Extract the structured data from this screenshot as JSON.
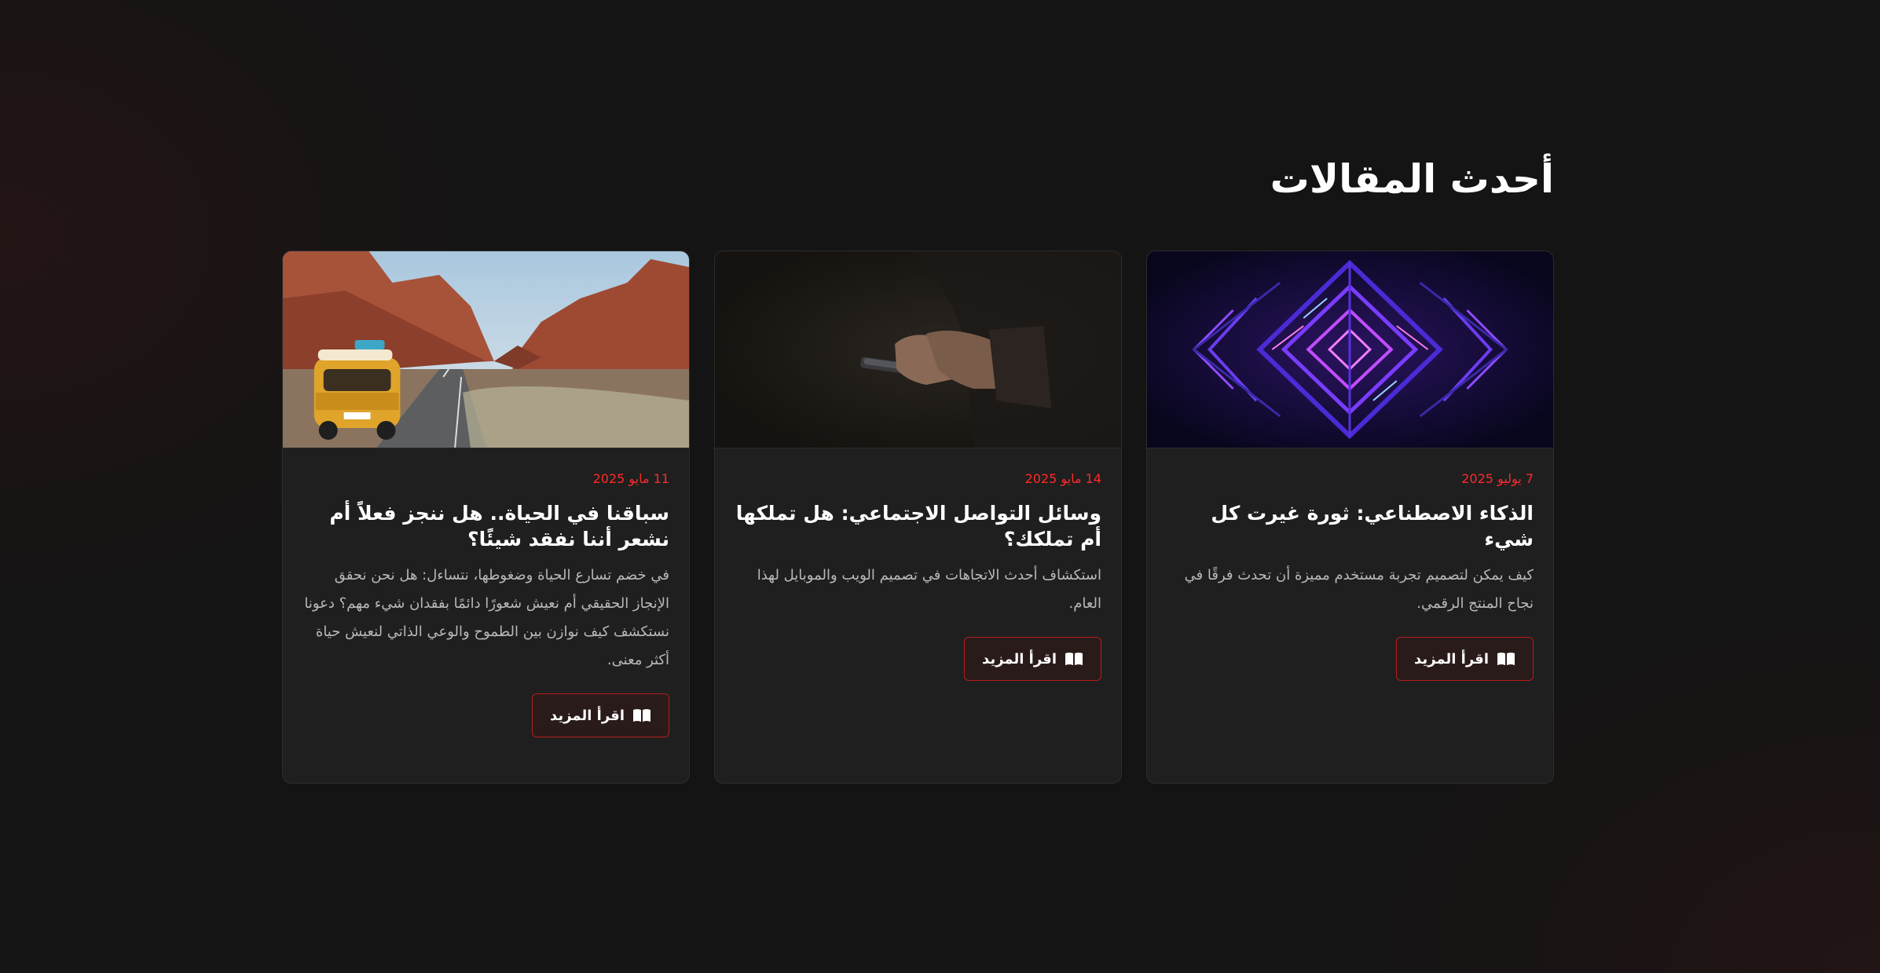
{
  "section": {
    "title": "أحدث المقالات"
  },
  "articles": [
    {
      "date": "7 يوليو 2025",
      "title": "الذكاء الاصطناعي: ثورة غيرت كل شيء",
      "excerpt": "كيف يمكن لتصميم تجربة مستخدم مميزة أن تحدث فرقًا في نجاح المنتج الرقمي.",
      "button_label": "اقرأ المزيد",
      "image": "abstract-neon-geometric-image"
    },
    {
      "date": "14 مايو 2025",
      "title": "وسائل التواصل الاجتماعي: هل تملكها أم تملكك؟",
      "excerpt": "استكشاف أحدث الاتجاهات في تصميم الويب والموبايل لهذا العام.",
      "button_label": "اقرأ المزيد",
      "image": "hands-holding-phone-image"
    },
    {
      "date": "11 مايو 2025",
      "title": "سباقنا في الحياة.. هل ننجز فعلاً أم نشعر أننا نفقد شيئًا؟",
      "excerpt": "في خضم تسارع الحياة وضغوطها، نتساءل: هل نحن نحقق الإنجاز الحقيقي أم نعيش شعورًا دائمًا بفقدان شيء مهم؟ دعونا نستكشف كيف نوازن بين الطموح والوعي الذاتي لنعيش حياة أكثر معنى.",
      "button_label": "اقرأ المزيد",
      "image": "van-on-desert-road-image"
    }
  ],
  "colors": {
    "background": "#141414",
    "card": "#1f1f1f",
    "accent": "#ff2a2a",
    "button_border": "#b51c1c"
  },
  "icons": {
    "button_icon": "open-book-icon"
  }
}
